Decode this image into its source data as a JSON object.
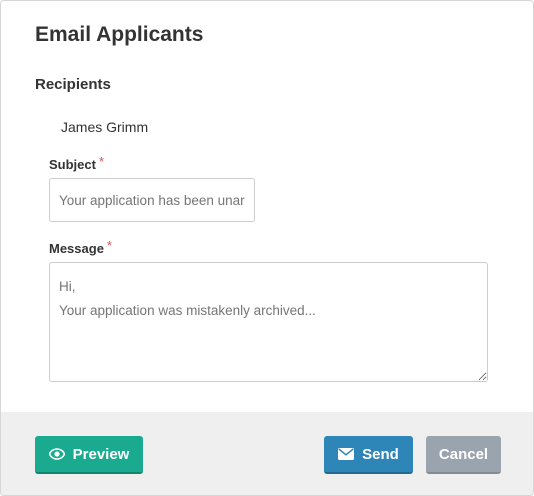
{
  "dialog": {
    "title": "Email Applicants",
    "recipients_label": "Recipients",
    "recipients": [
      "James Grimm"
    ]
  },
  "form": {
    "subject_label": "Subject",
    "subject_required_mark": "*",
    "subject_placeholder": "Your application has been unarchived",
    "message_label": "Message",
    "message_required_mark": "*",
    "message_placeholder": "Hi,\nYour application was mistakenly archived..."
  },
  "footer": {
    "preview_label": "Preview",
    "preview_icon": "eye-icon",
    "send_label": "Send",
    "send_icon": "envelope-icon",
    "cancel_label": "Cancel"
  },
  "colors": {
    "preview": "#1aaa8f",
    "send": "#2e86b8",
    "cancel": "#9aa4ae",
    "required": "#d9534f"
  }
}
